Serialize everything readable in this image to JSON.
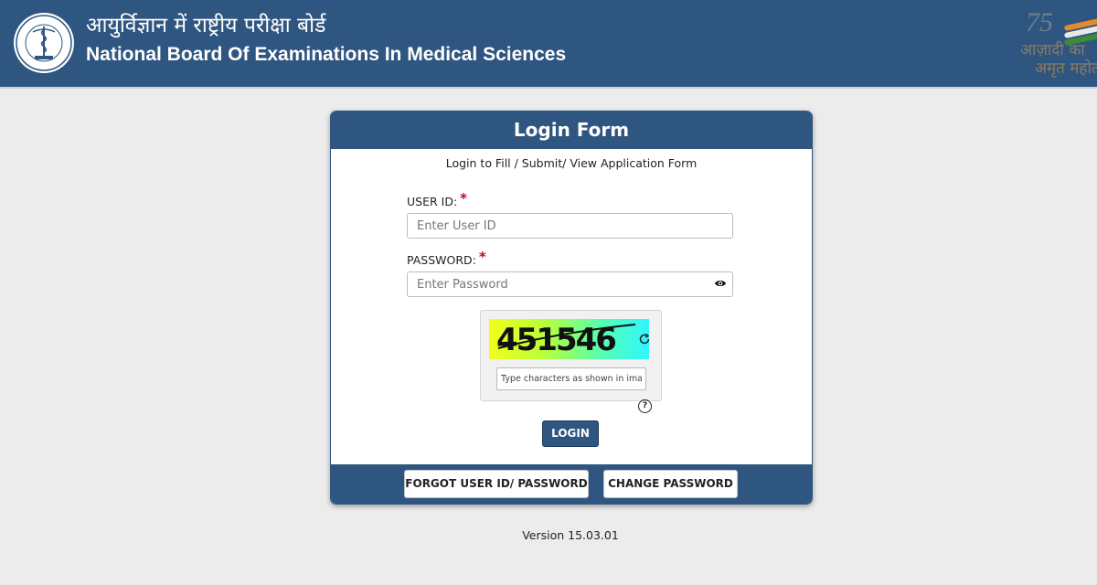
{
  "header": {
    "title_hindi": "आयुर्विज्ञान में राष्ट्रीय परीक्षा बोर्ड",
    "title_english": "National Board Of Examinations In Medical Sciences",
    "azadi_number": "75",
    "azadi_line1": "आज़ादी का",
    "azadi_line2": "अमृत महोत्सव"
  },
  "form": {
    "title": "Login Form",
    "subtitle": "Login to Fill / Submit/ View Application Form",
    "user_id_label": "USER ID:",
    "user_id_placeholder": "Enter User ID",
    "password_label": "PASSWORD:",
    "password_placeholder": "Enter Password",
    "required_mark": "*",
    "captcha_code": "451546",
    "captcha_placeholder": "Type characters as shown in image",
    "help_symbol": "?",
    "login_label": "LOGIN",
    "forgot_label": "FORGOT USER ID/ PASSWORD",
    "change_password_label": "CHANGE PASSWORD"
  },
  "footer": {
    "version": "Version 15.03.01"
  },
  "colors": {
    "primary": "#2f5680",
    "background": "#ececec",
    "required": "#d0021b"
  },
  "icons": [
    "emblem-logo",
    "azadi-logo",
    "eye-icon",
    "refresh-icon",
    "help-icon"
  ]
}
